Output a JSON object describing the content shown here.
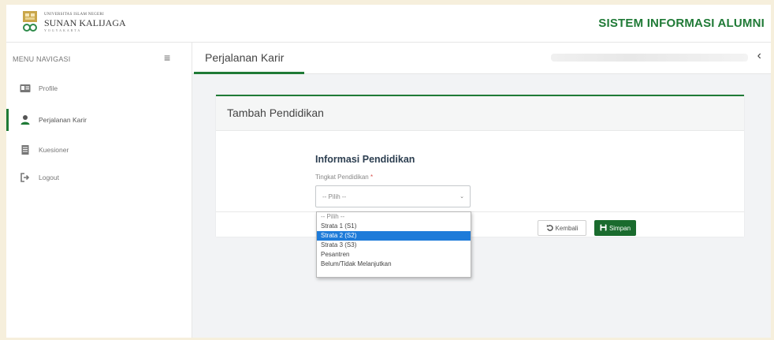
{
  "header": {
    "logo_small": "UNIVERSITAS ISLAM NEGERI",
    "logo_main": "SUNAN KALIJAGA",
    "logo_sub": "YOGYAKARTA",
    "app_title": "SISTEM INFORMASI ALUMNI"
  },
  "sidebar": {
    "menu_header": "MENU NAVIGASI",
    "items": [
      {
        "label": "Profile",
        "icon": "id-card-icon"
      },
      {
        "label": "Perjalanan Karir",
        "icon": "user-icon"
      },
      {
        "label": "Kuesioner",
        "icon": "document-icon"
      },
      {
        "label": "Logout",
        "icon": "logout-icon"
      }
    ],
    "active_index": 1
  },
  "content_header": {
    "page_title": "Perjalanan Karir"
  },
  "card": {
    "title": "Tambah Pendidikan",
    "section_title": "Informasi Pendidikan",
    "field_label": "Tingkat Pendidikan",
    "required_mark": "*",
    "select_value": "-- Pilih --",
    "options": [
      "-- Pilih --",
      "Strata 1 (S1)",
      "Strata 2 (S2)",
      "Strata 3 (S3)",
      "Pesantren",
      "Belum/Tidak Melanjutkan"
    ],
    "highlighted_option": "Strata 2 (S2)",
    "btn_back": "Kembali",
    "btn_save": "Simpan"
  },
  "colors": {
    "accent": "#1f7a36",
    "save_button": "#1a6b2e",
    "highlight": "#1e7bd9"
  }
}
